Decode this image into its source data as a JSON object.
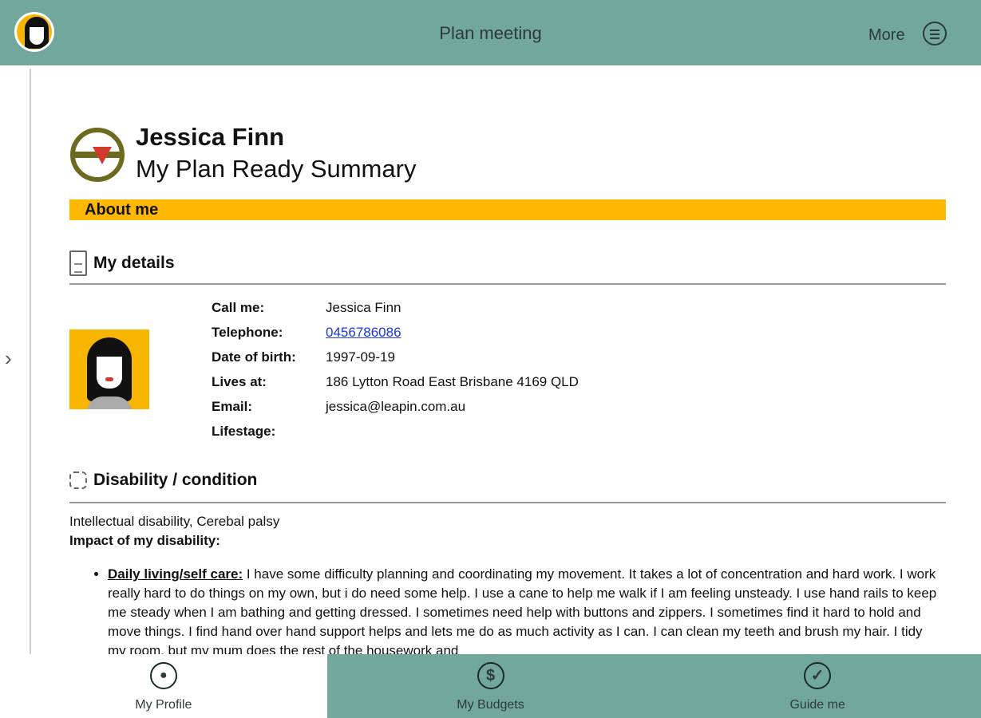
{
  "header": {
    "title": "Plan meeting",
    "more_label": "More"
  },
  "profile": {
    "name": "Jessica Finn",
    "subtitle": "My Plan Ready Summary"
  },
  "about_me": "About me",
  "my_details": {
    "heading": "My details",
    "rows": [
      {
        "label": "Call me:",
        "value": "Jessica Finn"
      },
      {
        "label": "Telephone:",
        "value": "0456786086"
      },
      {
        "label": "Date of birth:",
        "value": "1997-09-19"
      },
      {
        "label": "Lives at:",
        "value": "186 Lytton Road East Brisbane 4169 QLD"
      },
      {
        "label": "Email:",
        "value": "jessica@leapin.com.au"
      },
      {
        "label": "Lifestage:",
        "value": ""
      }
    ]
  },
  "disability": {
    "heading": "Disability / condition",
    "conditions": "Intellectual disability, Cerebal palsy",
    "impact_label": "Impact of my disability:",
    "items": [
      {
        "title": "Daily living/self care:",
        "text": " I have some difficulty planning and coordinating my movement. It takes a lot of concentration and hard work. I work really hard to do things on my own, but i do need some help. I use a cane to help me walk if I am feeling unsteady. I use hand rails to keep me steady when I am bathing and getting dressed. I sometimes need help with buttons and zippers. I sometimes find it hard to hold and move things. I find hand over hand support helps and lets me do as much activity as I can. I can clean my teeth and brush my hair. I tidy my room, but my mum does the rest of the housework and"
      }
    ]
  },
  "nav": [
    {
      "label": "My Profile",
      "icon": "person-icon",
      "glyph": "👤"
    },
    {
      "label": "My Budgets",
      "icon": "dollar-icon",
      "glyph": "$"
    },
    {
      "label": "Guide me",
      "icon": "checklist-icon",
      "glyph": "✓"
    }
  ],
  "colors": {
    "teal": "#72a79d",
    "yellow": "#ffb800",
    "link": "#1a37e0"
  }
}
